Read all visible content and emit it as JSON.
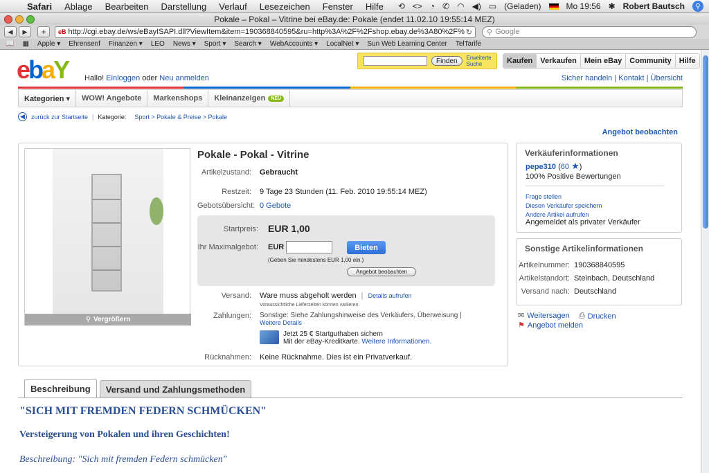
{
  "menubar": {
    "app": "Safari",
    "items": [
      "Ablage",
      "Bearbeiten",
      "Darstellung",
      "Verlauf",
      "Lesezeichen",
      "Fenster",
      "Hilfe"
    ],
    "battery": "(Geladen)",
    "clock": "Mo 19:56",
    "user": "Robert Bautsch"
  },
  "window": {
    "title": "Pokale – Pokal – Vitrine bei eBay.de: Pokale (endet 11.02.10 19:55:14 MEZ)"
  },
  "toolbar": {
    "url": "http://cgi.ebay.de/ws/eBayISAPI.dll?ViewItem&item=190368840595&ru=http%3A%2F%2Fshop.ebay.de%3A80%2F%3F_from%",
    "search_placeholder": "Google"
  },
  "bookmarks": [
    "Apple ▾",
    "Ehrensenf",
    "Finanzen ▾",
    "LEO",
    "News ▾",
    "Sport ▾",
    "Search ▾",
    "WebAccounts ▾",
    "LocalNet ▾",
    "Sun Web Learning Center",
    "TelTarife"
  ],
  "ebay": {
    "hallo_prefix": "Hallo!",
    "login": "Einloggen",
    "or": "oder",
    "register": "Neu anmelden",
    "find_button": "Finden",
    "advanced_search": "Erweiterte Suche",
    "topnav": [
      "Kaufen",
      "Verkaufen",
      "Mein eBay",
      "Community",
      "Hilfe"
    ],
    "helplinks": "Sicher handeln | Kontakt | Übersicht",
    "categories": [
      "Kategorien ▾",
      "WOW! Angebote",
      "Markenshops",
      "Kleinanzeigen"
    ],
    "new_badge": "NEU"
  },
  "breadcrumb": {
    "back": "zurück zur Startseite",
    "label": "Kategorie:",
    "path": "Sport > Pokale & Preise > Pokale"
  },
  "watch_link": "Angebot beobachten",
  "item": {
    "title": "Pokale - Pokal - Vitrine",
    "zoom": "Vergrößern",
    "condition_label": "Artikelzustand:",
    "condition": "Gebraucht",
    "remaining_label": "Restzeit:",
    "remaining": "9 Tage 23 Stunden (11. Feb. 2010 19:55:14 MEZ)",
    "bids_label": "Gebotsübersicht:",
    "bids": "0 Gebote",
    "start_price_label": "Startpreis:",
    "start_price": "EUR 1,00",
    "max_bid_label": "Ihr Maximalgebot:",
    "currency": "EUR",
    "bid_button": "Bieten",
    "bid_hint": "(Geben Sie mindestens EUR 1,00 ein.)",
    "watch_button": "Angebot beobachten",
    "shipping_label": "Versand:",
    "shipping": "Ware muss abgeholt werden",
    "shipping_details": "Details aufrufen",
    "shipping_note": "Voraussichtliche Lieferzeiten können variieren.",
    "payment_label": "Zahlungen:",
    "payment": "Sonstige: Siehe Zahlungshinweise des Verkäufers, Überweisung |",
    "payment_details": "Weitere Details",
    "credit_line1": "Jetzt 25 € Startguthaben sichern",
    "credit_line2": "Mit der eBay-Kreditkarte.",
    "credit_more": "Weitere Informationen.",
    "returns_label": "Rücknahmen:",
    "returns": "Keine Rücknahme. Dies ist ein Privatverkauf."
  },
  "seller": {
    "heading": "Verkäuferinformationen",
    "name": "pepe310",
    "score": "60",
    "positive": "100% Positive Bewertungen",
    "ask": "Frage stellen",
    "save": "Diesen Verkäufer speichern",
    "other_items": "Andere Artikel aufrufen",
    "private": "Angemeldet als privater Verkäufer"
  },
  "other_info": {
    "heading": "Sonstige Artikelinformationen",
    "rows": [
      {
        "label": "Artikelnummer:",
        "value": "190368840595"
      },
      {
        "label": "Artikelstandort:",
        "value": "Steinbach, Deutschland"
      },
      {
        "label": "Versand nach:",
        "value": "Deutschland"
      }
    ]
  },
  "actions": {
    "share": "Weitersagen",
    "print": "Drucken",
    "report": "Angebot melden"
  },
  "tabs": [
    "Beschreibung",
    "Versand und Zahlungsmethoden"
  ],
  "description": {
    "headline": "\"SICH MIT FREMDEN FEDERN SCHMÜCKEN\"",
    "subline": "Versteigerung von Pokalen und ihren Geschichten!",
    "partial": "Beschreibung: \"Sich mit fremden Federn schmücken\""
  }
}
